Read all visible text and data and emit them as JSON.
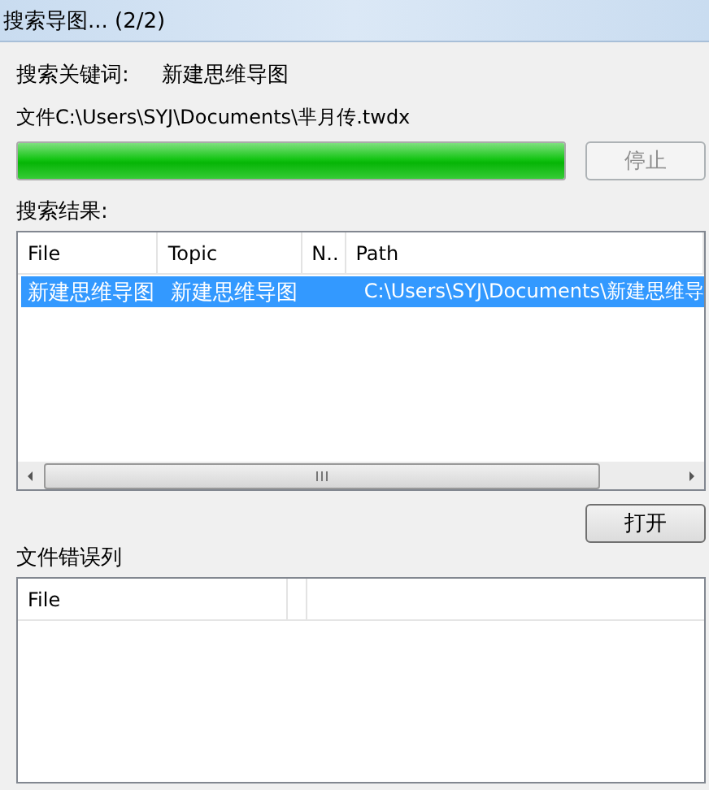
{
  "window": {
    "title": "搜索导图... (2/2)"
  },
  "keyword": {
    "label": "搜索关键词:",
    "value": "新建思维导图"
  },
  "current_file": "文件C:\\Users\\SYJ\\Documents\\芈月传.twdx",
  "progress": {
    "level": 1.0
  },
  "stop_button": {
    "label": "停止",
    "disabled": true
  },
  "results": {
    "label": "搜索结果:",
    "columns": [
      "File",
      "Topic",
      "N..",
      "Path"
    ],
    "rows": [
      {
        "cells": [
          "新建思维导图",
          "新建思维导图",
          "",
          "C:\\Users\\SYJ\\Documents\\新建思维导"
        ],
        "selected": true
      }
    ]
  },
  "open_button": {
    "label": "打开",
    "disabled": false
  },
  "errors": {
    "label": "文件错误列",
    "columns": [
      "File"
    ]
  }
}
